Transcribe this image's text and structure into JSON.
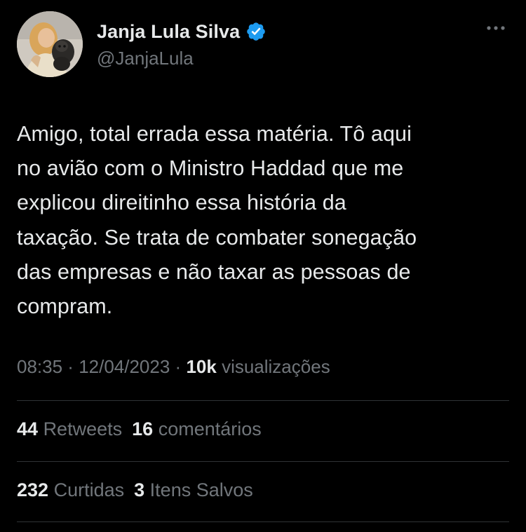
{
  "author": {
    "display_name": "Janja Lula Silva",
    "handle": "@JanjaLula",
    "verified": true
  },
  "tweet": {
    "text": "Amigo, total errada essa matéria. Tô aqui\nno avião com o Ministro Haddad que me\nexplicou direitinho essa história da\ntaxação. Se trata de combater sonegação\ndas empresas e não taxar as pessoas de\ncompram."
  },
  "meta": {
    "time": "08:35",
    "separator": " · ",
    "date": "12/04/2023",
    "views_count": "10k",
    "views_label": "visualizações"
  },
  "stats": {
    "retweets_count": "44",
    "retweets_label": "Retweets",
    "comments_count": "16",
    "comments_label": "comentários",
    "likes_count": "232",
    "likes_label": "Curtidas",
    "saves_count": "3",
    "saves_label": "Itens Salvos"
  },
  "icons": {
    "verified": "verified-badge-icon",
    "more": "more-options-icon"
  },
  "colors": {
    "background": "#000000",
    "primary_text": "#e7e9ea",
    "secondary_text": "#71767b",
    "verified_blue": "#1d9bf0",
    "divider": "#2f3336"
  }
}
